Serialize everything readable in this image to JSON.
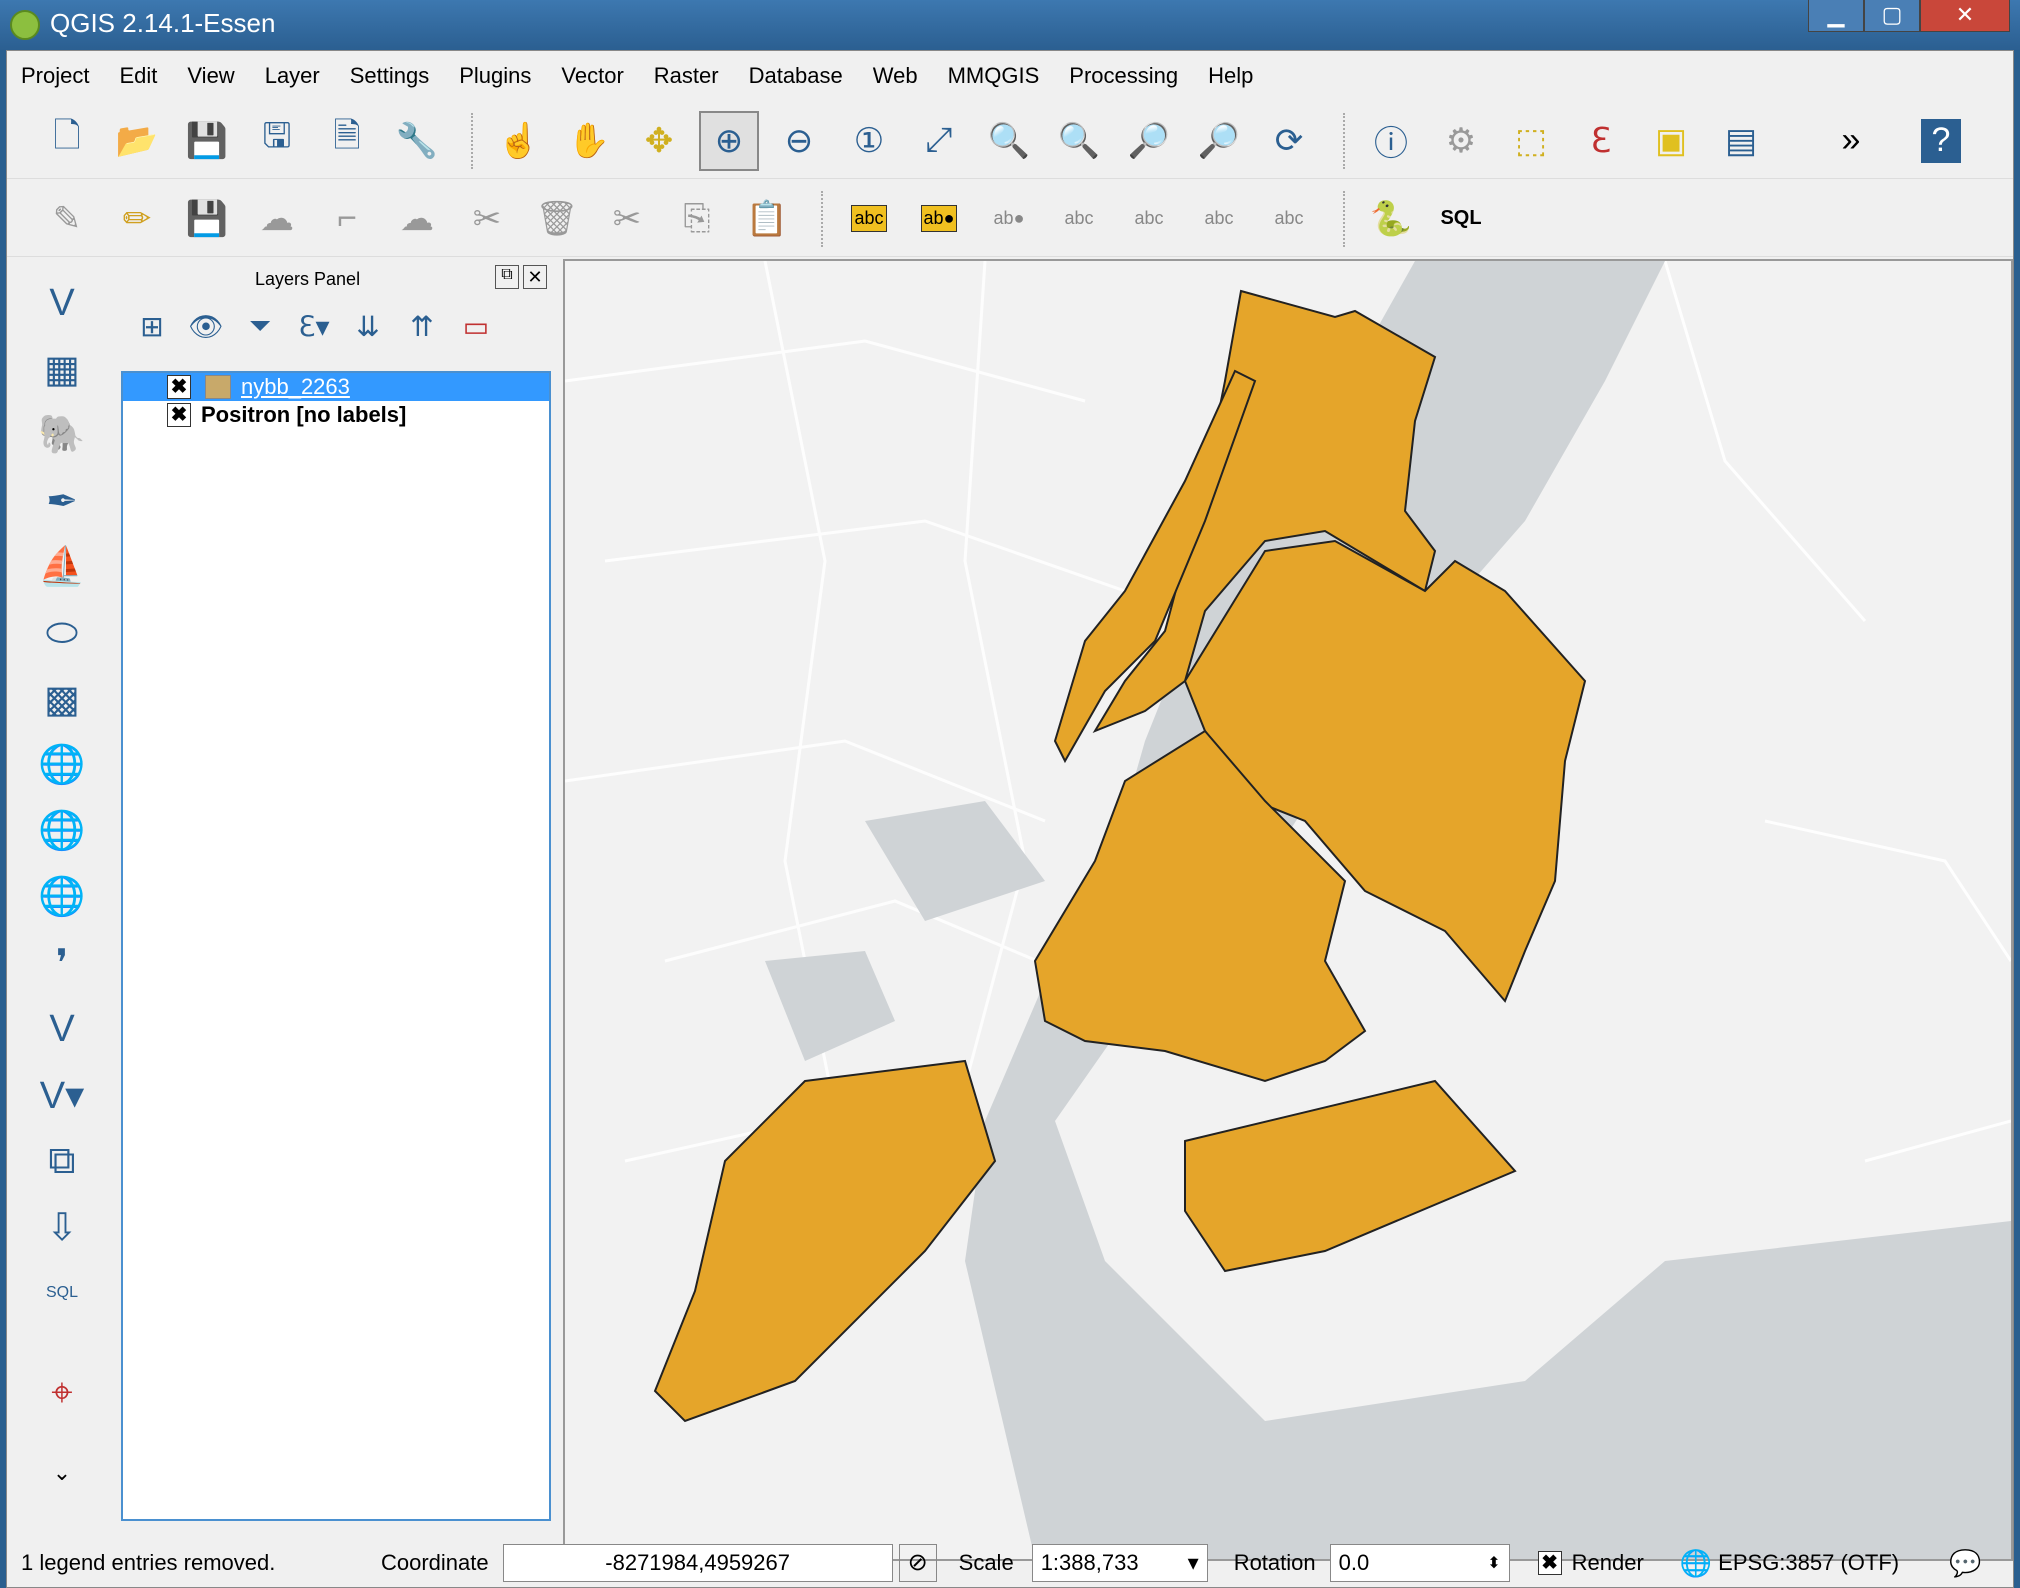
{
  "window": {
    "title": "QGIS 2.14.1-Essen",
    "minimize": "▁",
    "maximize": "▢",
    "close": "✕"
  },
  "menu": [
    "Project",
    "Edit",
    "View",
    "Layer",
    "Settings",
    "Plugins",
    "Vector",
    "Raster",
    "Database",
    "Web",
    "MMQGIS",
    "Processing",
    "Help"
  ],
  "layers_panel": {
    "title": "Layers Panel",
    "layers": [
      {
        "name": "nybb_2263",
        "checked": true,
        "selected": true
      },
      {
        "name": "Positron [no labels]",
        "checked": true,
        "selected": false
      }
    ]
  },
  "toolbar2": {
    "sql_label": "SQL"
  },
  "map": {
    "fill_color": "#e5a52a",
    "water_color": "#cfd3d6",
    "land_color": "#f2f2f2"
  },
  "status": {
    "message": "1 legend entries removed.",
    "coordinate_label": "Coordinate",
    "coordinate_value": "-8271984,4959267",
    "scale_label": "Scale",
    "scale_value": "1:388,733",
    "rotation_label": "Rotation",
    "rotation_value": "0.0",
    "render_label": "Render",
    "crs": "EPSG:3857 (OTF)"
  }
}
